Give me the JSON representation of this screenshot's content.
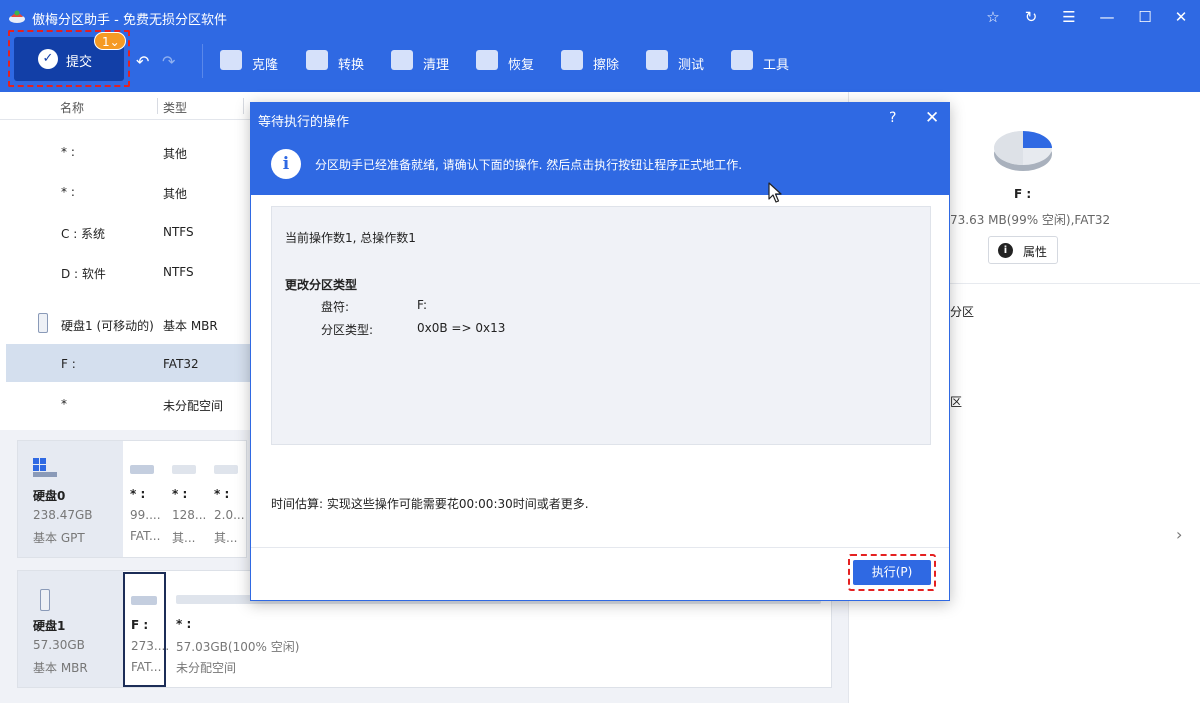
{
  "app": {
    "title": "傲梅分区助手 - 免费无损分区软件"
  },
  "window_controls": {
    "star": "☆",
    "refresh": "↻",
    "menu": "☰",
    "minimize": "—",
    "maximize": "☐",
    "close": "✕"
  },
  "toolbar": {
    "submit_label": "提交",
    "submit_badge": "1⌄",
    "undo": "↶",
    "redo": "↷",
    "tools": [
      {
        "label": "克隆",
        "icon": "clone-icon"
      },
      {
        "label": "转换",
        "icon": "convert-icon"
      },
      {
        "label": "清理",
        "icon": "clean-icon"
      },
      {
        "label": "恢复",
        "icon": "recover-icon"
      },
      {
        "label": "擦除",
        "icon": "wipe-icon"
      },
      {
        "label": "测试",
        "icon": "test-icon"
      },
      {
        "label": "工具",
        "icon": "tools-icon"
      }
    ]
  },
  "table": {
    "columns": [
      "名称",
      "类型"
    ],
    "rows": [
      {
        "name": "* :",
        "type": "其他"
      },
      {
        "name": "* :",
        "type": "其他"
      },
      {
        "name": "C : 系统",
        "type": "NTFS"
      },
      {
        "name": "D : 软件",
        "type": "NTFS"
      },
      {
        "name": "硬盘1 (可移动的)",
        "type": "基本 MBR"
      },
      {
        "name": "F :",
        "type": "FAT32"
      },
      {
        "name": "*",
        "type": "未分配空间"
      }
    ]
  },
  "disks": [
    {
      "name": "硬盘0",
      "size": "238.47GB",
      "style": "基本 GPT",
      "segments": [
        {
          "label": "* :",
          "size": "99....",
          "fs": "FAT..."
        },
        {
          "label": "* :",
          "size": "128...",
          "fs": "其..."
        },
        {
          "label": "* :",
          "size": "2.0...",
          "fs": "其..."
        }
      ]
    },
    {
      "name": "硬盘1",
      "size": "57.30GB",
      "style": "基本 MBR",
      "segments": [
        {
          "label": "F :",
          "size": "273....",
          "fs": "FAT..."
        },
        {
          "label": "* :",
          "size": "57.03GB(100% 空闲)",
          "fs": "未分配空间"
        }
      ]
    }
  ],
  "right_panel": {
    "drive": "F :",
    "detail": "73.63 MB(99% 空闲),FAT32",
    "properties_label": "属性",
    "text1": "分区",
    "text2": "区",
    "chevron": "›"
  },
  "dialog": {
    "title": "等待执行的操作",
    "help": "?",
    "close": "✕",
    "info": "分区助手已经准备就绪, 请确认下面的操作. 然后点击执行按钮让程序正式地工作.",
    "ops_count": "当前操作数1, 总操作数1",
    "op_heading": "更改分区类型",
    "op_fields": [
      {
        "key": "盘符:",
        "value": "F:"
      },
      {
        "key": "分区类型:",
        "value": "0x0B => 0x13"
      }
    ],
    "time_estimate": "时间估算: 实现这些操作可能需要花00:00:30时间或者更多.",
    "execute_label": "执行(P)"
  },
  "colors": {
    "brand_blue": "#2f69e3",
    "submit_dark": "#123fa7",
    "badge_orange": "#f59a24",
    "highlight_red": "#e42121",
    "selected_row": "#d4dfee"
  }
}
